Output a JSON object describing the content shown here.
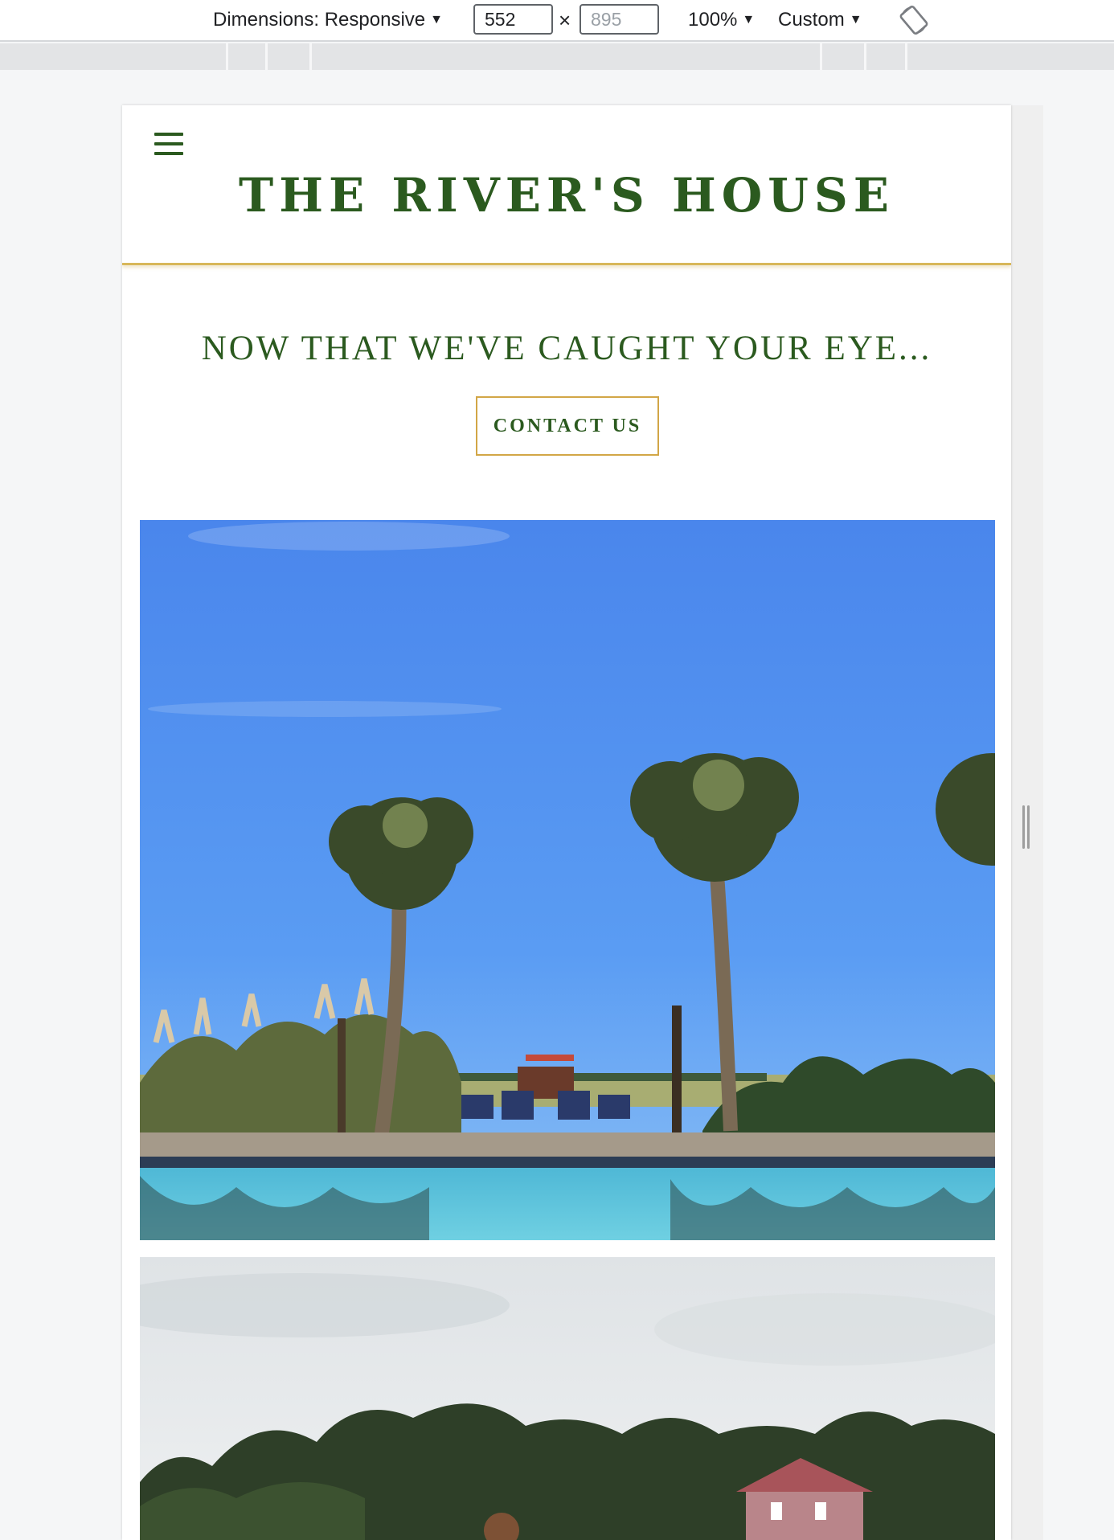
{
  "devtools": {
    "dimensions_label": "Dimensions: Responsive",
    "width_value": "552",
    "height_placeholder": "895",
    "times_symbol": "×",
    "zoom_label": "100%",
    "throttle_label": "Custom",
    "dropdown_glyph": "▼"
  },
  "site": {
    "title": "THE RIVER'S HOUSE",
    "tagline": "NOW THAT WE'VE CAUGHT YOUR EYE...",
    "cta_label": "CONTACT US"
  },
  "colors": {
    "brand_green": "#2b5a1f",
    "accent_gold": "#d2a646"
  }
}
